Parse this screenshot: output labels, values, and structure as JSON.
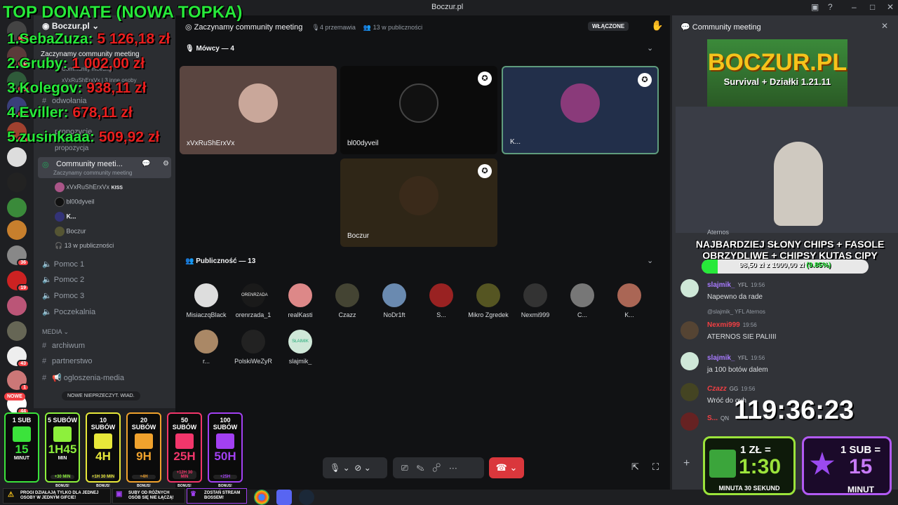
{
  "window": {
    "title": "Boczur.pl"
  },
  "sidebar": {
    "server_name": "Boczur.pl",
    "top_event": "Zaczynamy community meeting",
    "top_event_sub": "Community meeting",
    "top_event_people": "xVxRuShErxVx | 3 inne osoby",
    "channels_top": [
      "odwołania",
      "propozycje",
      "propozycja"
    ],
    "active_channel": "Community meeti...",
    "active_channel_sub": "Zaczynamy community meeting",
    "members": [
      {
        "name": "xVxRuShErxVx",
        "tag": "KISS"
      },
      {
        "name": "bl00dyveil",
        "tag": ""
      },
      {
        "name": "K...",
        "tag": ""
      },
      {
        "name": "Boczur",
        "tag": ""
      }
    ],
    "audience_line": "13 w publiczności",
    "voice_channels": [
      "Pomoc 1",
      "Pomoc 2",
      "Pomoc 3",
      "Poczekalnia"
    ],
    "category_media": "MEDIA",
    "media_channels": [
      "archiwum",
      "partnerstwo",
      "ogloszenia-media"
    ],
    "new_unread": "NOWE NIEPRZECZYT. WIAD.",
    "new_badge": "NOWE"
  },
  "stage": {
    "title": "Zaczynamy community meeting",
    "speakers_count": "4 przemawia",
    "audience_count": "13 w publiczności",
    "status": "WŁĄCZONE",
    "speakers_header": "Mówcy — 4",
    "speakers": [
      {
        "name": "xVxRuShErxVx",
        "bg": "#5a4540"
      },
      {
        "name": "bl00dyveil",
        "bg": "#0b0b0b"
      },
      {
        "name": "K...",
        "bg": "#222f4a"
      },
      {
        "name": "Boczur",
        "bg": "#2f2617"
      }
    ],
    "audience_header": "Publiczność — 13",
    "audience": [
      "MisiaczqBlack",
      "orenrzada_1",
      "realKasti",
      "Czazz",
      "NoDr1ft",
      "S...",
      "Mikro Zgredek",
      "Nexmi999",
      "C...",
      "K...",
      "r...",
      "PolskiWeZyR",
      "slajmik_"
    ],
    "audience_logo": "ORENRZADA",
    "audience_logo_2": "SŁAIMIK"
  },
  "chat": {
    "title": "Community meeting",
    "banner_title": "BOCZUR.PL",
    "banner_sub": "Survival + Działki 1.21.11",
    "goal_line_1": "NAJBARDZIEJ SŁONY CHIPS + FASOLE",
    "goal_line_2": "OBRZYDLIWE + CHIPSY KUTAS CIPY",
    "goal_amount": "98,50 zł z 1000,00 zł",
    "goal_percent": "(9.85%)",
    "goal_fraction": 0.0985,
    "aternos_top": "Aternos",
    "messages": [
      {
        "user": "slajmik_",
        "tag": "YFL",
        "time": "19:56",
        "text": "Napewno da rade",
        "color": "#a77aff",
        "reply": ""
      },
      {
        "user": "Nexmi999",
        "tag": "",
        "time": "19:56",
        "text": "ATERNOS SIE PALIIII",
        "color": "#f23f43",
        "reply": "@slajmik_  YFL  Aternos"
      },
      {
        "user": "slajmik_",
        "tag": "YFL",
        "time": "19:56",
        "text": "ja 100 botów dalem",
        "color": "#a77aff",
        "reply": ""
      },
      {
        "user": "Czazz",
        "tag": "GG",
        "time": "19:56",
        "text": "Wróć do ovh",
        "color": "#f23f43",
        "reply": ""
      },
      {
        "user": "S...",
        "tag": "QN",
        "time": "",
        "text": "",
        "color": "#f23f43",
        "reply": ""
      }
    ],
    "timer": "119:36:23"
  },
  "overlay": {
    "top_title": "TOP DONATE (NOWA TOPKA)",
    "donors": [
      {
        "rank": "1.",
        "name": "SebaZuza:",
        "amount": "5 126,18 zł"
      },
      {
        "rank": "2.",
        "name": "Gruby:",
        "amount": "1 002,00 zł"
      },
      {
        "rank": "3.",
        "name": "Kolegov:",
        "amount": "938,11 zł"
      },
      {
        "rank": "4.",
        "name": "Eviller:",
        "amount": "678,11 zł"
      },
      {
        "rank": "5.",
        "name": "zusinkaaa:",
        "amount": "509,92 zł"
      }
    ],
    "subcards": [
      {
        "title": "1 SUB",
        "big": "15",
        "small": "MINUT",
        "bonus": "",
        "color": "#3be33b"
      },
      {
        "title": "5 SUBÓW",
        "big": "1H45",
        "small": "MIN",
        "bonus": "+30 MIN",
        "color": "#8df03c"
      },
      {
        "title": "10 SUBÓW",
        "big": "4H",
        "small": "",
        "bonus": "+1H 30 MIN",
        "color": "#e8e83a"
      },
      {
        "title": "20 SUBÓW",
        "big": "9H",
        "small": "",
        "bonus": "+4H",
        "color": "#f0a22d"
      },
      {
        "title": "50 SUBÓW",
        "big": "25H",
        "small": "",
        "bonus": "+12H 30 MIN",
        "color": "#f2366b"
      },
      {
        "title": "100 SUBÓW",
        "big": "50H",
        "small": "",
        "bonus": "+25H",
        "color": "#a240f2"
      }
    ],
    "bonus_label": "BONUS!",
    "bottom_1": "PROGI DZIAŁAJĄ TYLKO DLA JEDNEJ OSOBY W JEDNYM GIFCIE!",
    "bottom_2": "SUBY OD RÓŻNYCH OSÓB SIĘ NIE ŁĄCZĄ!",
    "bottom_3": "ZOSTAŃ STREAM BOSSEM!",
    "rate_1_top": "1 ZŁ =",
    "rate_1_big": "1:30",
    "rate_1_bottom": "MINUTA 30 SEKUND",
    "rate_2_top": "1 SUB =",
    "rate_2_big": "15",
    "rate_2_bottom": "MINUT"
  }
}
